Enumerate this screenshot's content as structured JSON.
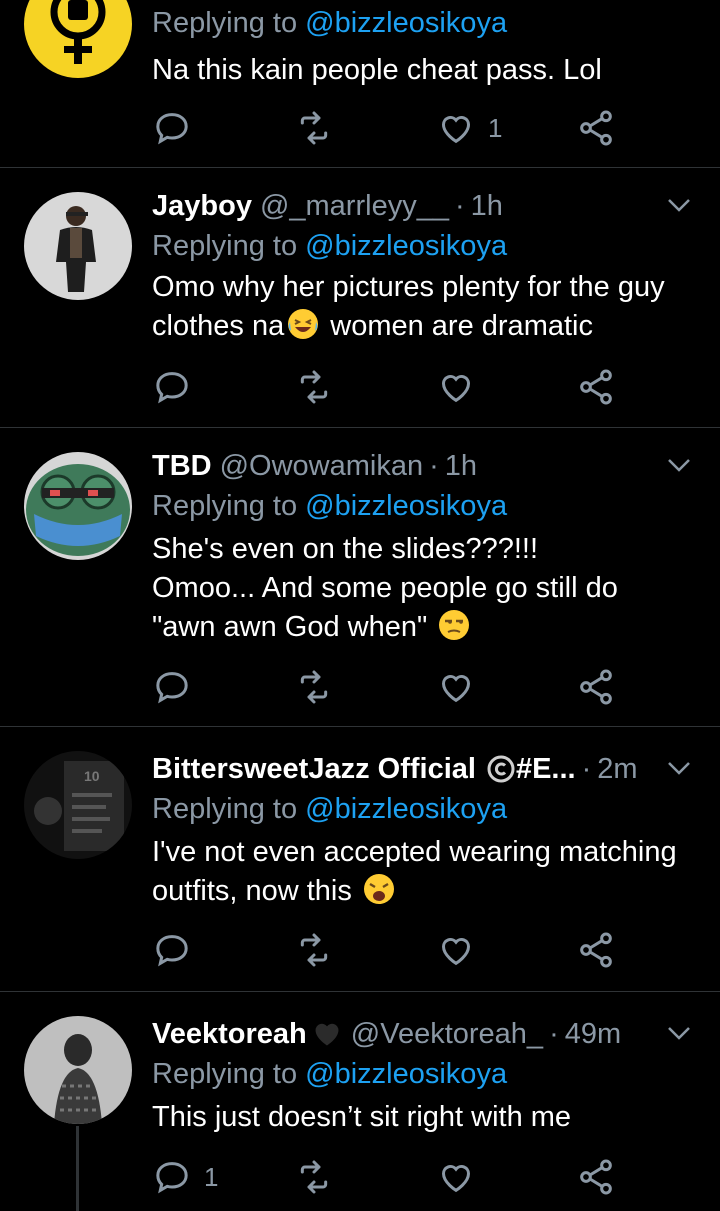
{
  "tweets": [
    {
      "name": "",
      "handle": "",
      "time": "",
      "replying_label": "Replying to",
      "mention": "@bizzleosikoya",
      "text": "Na this kain people cheat pass. Lol",
      "reply_count": "",
      "like_count": "1"
    },
    {
      "name": "Jayboy",
      "handle": "@_marrleyy__",
      "time": "1h",
      "replying_label": "Replying to",
      "mention": "@bizzleosikoya",
      "text_line1": "Omo why her pictures plenty for the guy",
      "text_line2a": "clothes na",
      "text_line2b": " women are dramatic",
      "reply_count": "",
      "like_count": ""
    },
    {
      "name": "TBD",
      "handle": "@Owowamikan",
      "time": "1h",
      "replying_label": "Replying to",
      "mention": "@bizzleosikoya",
      "text_line1": "She's even on the slides???!!!",
      "text_line2": "Omoo... And some people go still do",
      "text_line3": "\"awn awn God when\"",
      "reply_count": "",
      "like_count": ""
    },
    {
      "name": "BittersweetJazz Official",
      "name_suffix": " #E...",
      "time": "2m",
      "replying_label": "Replying to",
      "mention": "@bizzleosikoya",
      "text_line1": "I've not even accepted wearing matching",
      "text_line2": "outfits, now this",
      "reply_count": "",
      "like_count": ""
    },
    {
      "name": "Veektoreah",
      "handle": "@Veektoreah_",
      "time": "49m",
      "replying_label": "Replying to",
      "mention": "@bizzleosikoya",
      "text": "This just doesn’t sit right with me",
      "reply_count": "1",
      "like_count": ""
    }
  ],
  "separator": "·",
  "colors": {
    "background": "#000000",
    "divider": "#2f3336",
    "secondary_text": "#8b98a5",
    "mention": "#1da1f2",
    "icon": "#8b98a5"
  }
}
